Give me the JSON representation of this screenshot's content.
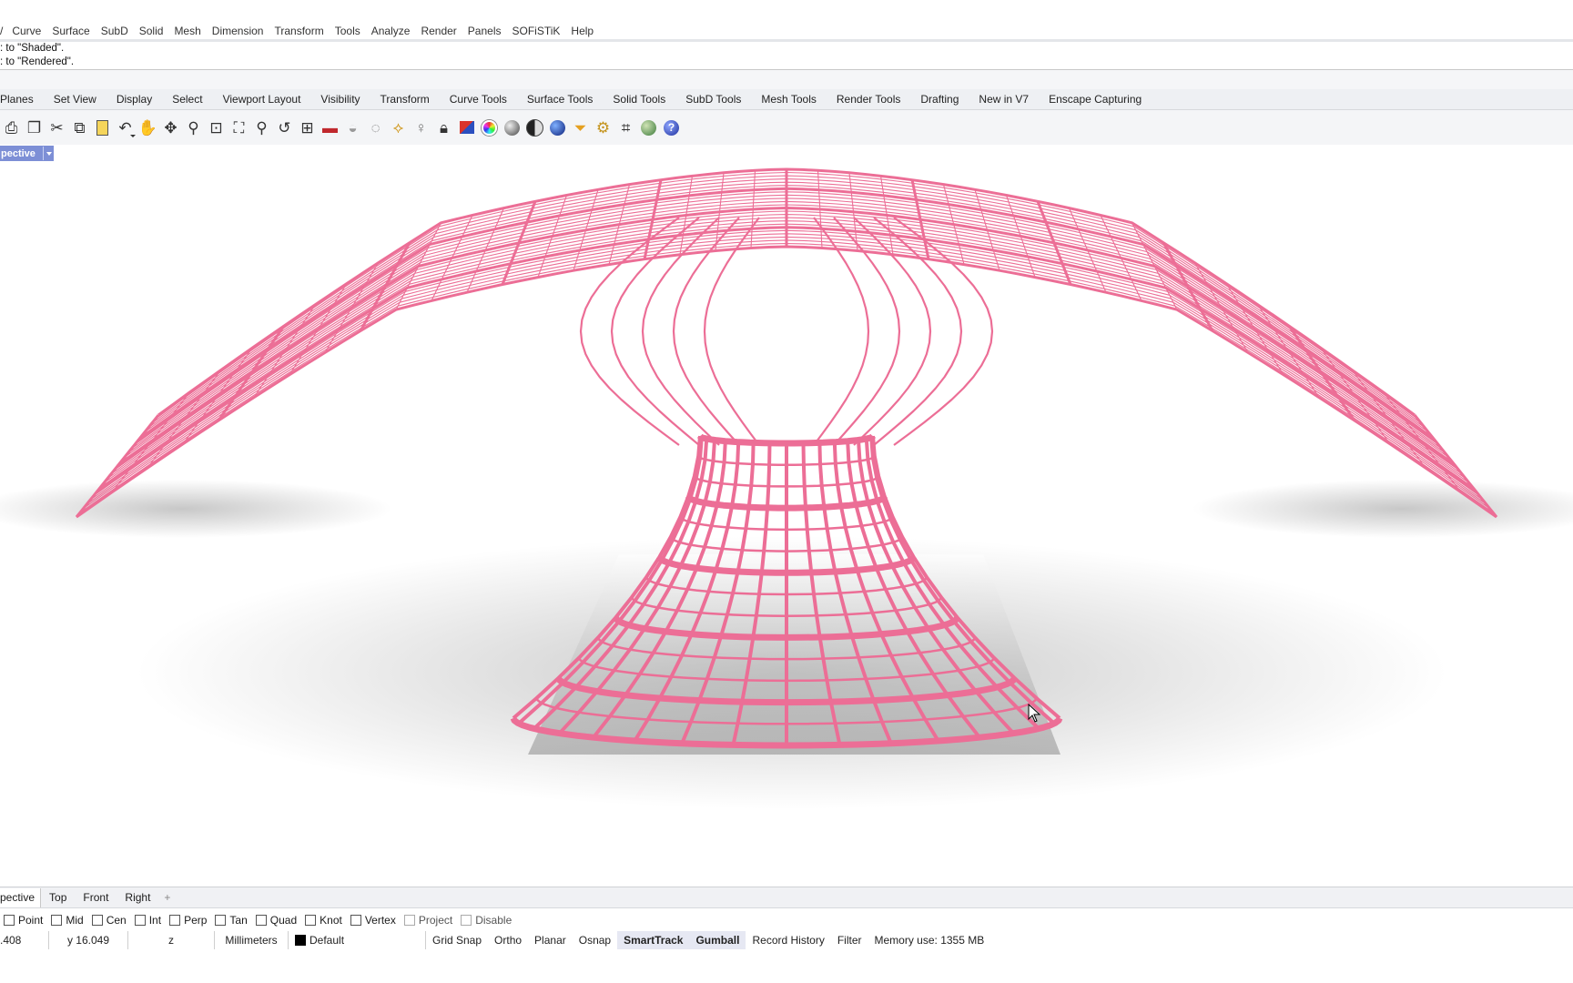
{
  "menubar": {
    "lead": "/",
    "items": [
      "Curve",
      "Surface",
      "SubD",
      "Solid",
      "Mesh",
      "Dimension",
      "Transform",
      "Tools",
      "Analyze",
      "Render",
      "Panels",
      "SOFiSTiK",
      "Help"
    ]
  },
  "command_history": [
    ": to \"Shaded\".",
    ": to \"Rendered\"."
  ],
  "toolbar_tabs": [
    "Planes",
    "Set View",
    "Display",
    "Select",
    "Viewport Layout",
    "Visibility",
    "Transform",
    "Curve Tools",
    "Surface Tools",
    "Solid Tools",
    "SubD Tools",
    "Mesh Tools",
    "Render Tools",
    "Drafting",
    "New in V7",
    "Enscape Capturing"
  ],
  "toolbar_icons": [
    "print-icon",
    "copy-object-icon",
    "cut-icon",
    "copy-icon",
    "paste-icon",
    "undo-icon",
    "pan-hand-icon",
    "rotate-view-icon",
    "zoom-icon",
    "zoom-window-icon",
    "zoom-extents-icon",
    "zoom-selected-icon",
    "undo-view-icon",
    "four-viewports-icon",
    "car-icon",
    "hide-icon",
    "cplane-icon",
    "snap-icon",
    "light-icon",
    "lock-icon",
    "layer-icon",
    "color-wheel-icon",
    "shade-icon",
    "render-preview-icon",
    "render-sphere-icon",
    "filter-icon",
    "options-gear-icon",
    "grid-icon",
    "globe-icon",
    "help-icon"
  ],
  "viewport": {
    "name": "pective",
    "render_color": "#ec6e96",
    "shadow_color": "#9a9a9a"
  },
  "viewport_tabs": {
    "active": "pective",
    "items": [
      "Top",
      "Front",
      "Right"
    ],
    "add": "+"
  },
  "osnaps": [
    {
      "label": "Point",
      "checked": false
    },
    {
      "label": "Mid",
      "checked": false
    },
    {
      "label": "Cen",
      "checked": false
    },
    {
      "label": "Int",
      "checked": false
    },
    {
      "label": "Perp",
      "checked": false
    },
    {
      "label": "Tan",
      "checked": false
    },
    {
      "label": "Quad",
      "checked": false
    },
    {
      "label": "Knot",
      "checked": false
    },
    {
      "label": "Vertex",
      "checked": false
    },
    {
      "label": "Project",
      "checked": false,
      "dim": true
    },
    {
      "label": "Disable",
      "checked": false,
      "dim": true
    }
  ],
  "status": {
    "x": ".408",
    "y": "y 16.049",
    "z": "z",
    "units": "Millimeters",
    "layer": "Default",
    "grid_snap": "Grid Snap",
    "ortho": "Ortho",
    "planar": "Planar",
    "osnap": "Osnap",
    "smarttrack": "SmartTrack",
    "gumball": "Gumball",
    "record_history": "Record History",
    "filter": "Filter",
    "memory": "Memory use: 1355 MB"
  }
}
